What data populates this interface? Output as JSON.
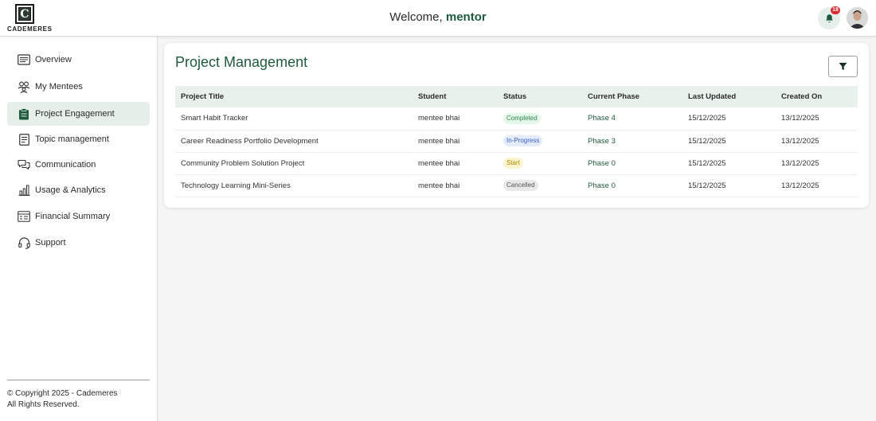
{
  "brand": {
    "name": "Cademeres",
    "logo_letter": "C"
  },
  "header": {
    "welcome_prefix": "Welcome,",
    "user_name": "mentor",
    "notification_count": "18"
  },
  "sidebar": {
    "items": [
      {
        "label": "Overview",
        "icon": "overview-icon"
      },
      {
        "label": "My Mentees",
        "icon": "mentees-icon"
      },
      {
        "label": "Project Engagement",
        "icon": "project-icon",
        "active": true
      },
      {
        "label": "Topic management",
        "icon": "topic-icon"
      },
      {
        "label": "Communication",
        "icon": "chat-icon"
      },
      {
        "label": "Usage & Analytics",
        "icon": "analytics-icon"
      },
      {
        "label": "Financial Summary",
        "icon": "finance-icon"
      },
      {
        "label": "Support",
        "icon": "headset-icon"
      }
    ],
    "copyright_line1": "© Copyright 2025 - Cademeres",
    "copyright_line2": "All Rights Reserved."
  },
  "main": {
    "title": "Project Management",
    "table": {
      "headers": [
        "Project Title",
        "Student",
        "Status",
        "Current Phase",
        "Last Updated",
        "Created On"
      ],
      "rows": [
        {
          "title": "Smart Habit Tracker",
          "student": "mentee bhai",
          "status": "Completed",
          "phase": "Phase 4",
          "updated": "15/12/2025",
          "created": "13/12/2025"
        },
        {
          "title": "Career Readiness Portfolio Development",
          "student": "mentee bhai",
          "status": "In-Progress",
          "phase": "Phase 3",
          "updated": "15/12/2025",
          "created": "13/12/2025"
        },
        {
          "title": "Community Problem Solution Project",
          "student": "mentee bhai",
          "status": "Start",
          "phase": "Phase 0",
          "updated": "15/12/2025",
          "created": "13/12/2025"
        },
        {
          "title": "Technology Learning Mini-Series",
          "student": "mentee bhai",
          "status": "Cancelled",
          "phase": "Phase 0",
          "updated": "15/12/2025",
          "created": "13/12/2025"
        }
      ]
    }
  },
  "colors": {
    "accent": "#1f5a3c",
    "active_bg": "#e6efe9",
    "badge": "#d92b2b"
  }
}
